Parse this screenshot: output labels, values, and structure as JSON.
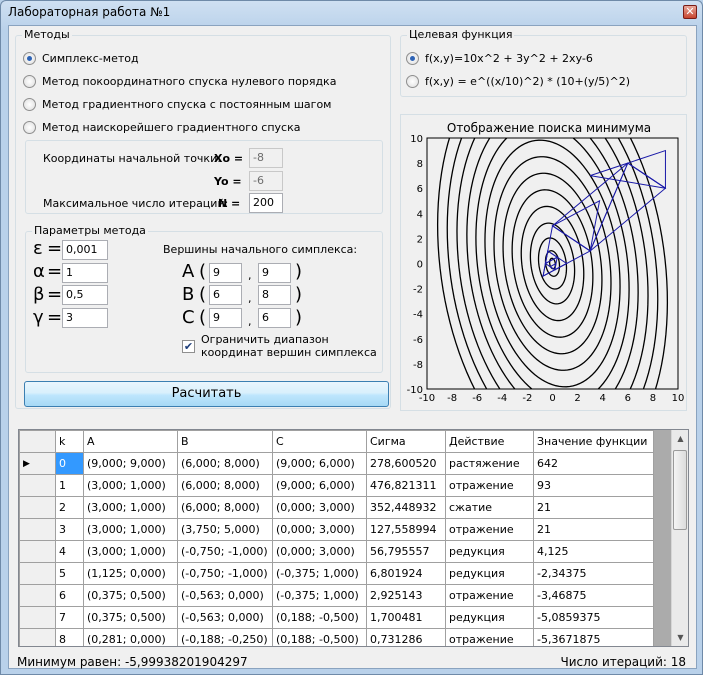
{
  "window": {
    "title": "Лабораторная работа №1",
    "close_glyph": "✕"
  },
  "methods": {
    "title": "Методы",
    "items": [
      {
        "label": "Симплекс-метод",
        "checked": true
      },
      {
        "label": "Метод покоординатного спуска нулевого порядка",
        "checked": false
      },
      {
        "label": "Метод градиентного спуска с постоянным шагом",
        "checked": false
      },
      {
        "label": "Метод наискорейшего градиентного спуска",
        "checked": false
      }
    ]
  },
  "start": {
    "coords_label": "Координаты начальной точки:",
    "x0_label": "Xo =",
    "x0_value": "-8",
    "y0_label": "Yo =",
    "y0_value": "-6",
    "max_iter_label": "Максимальное число итераций:",
    "n_label": "N =",
    "n_value": "200"
  },
  "params": {
    "title": "Параметры метода",
    "eps_sym": "ε",
    "eps_value": "0,001",
    "alpha_sym": "α",
    "alpha_value": "1",
    "beta_sym": "β",
    "beta_value": "0,5",
    "gamma_sym": "γ",
    "gamma_value": "3",
    "eq": "=",
    "vertices_label": "Вершины начального симплекса:",
    "A": {
      "name": "A",
      "x": "9",
      "y": "9"
    },
    "B": {
      "name": "B",
      "x": "6",
      "y": "8"
    },
    "C": {
      "name": "C",
      "x": "9",
      "y": "6"
    },
    "restrict_label_1": "Ограничить диапазон",
    "restrict_label_2": "координат вершин симплекса",
    "restrict_checked": true
  },
  "calc_button": "Расчитать",
  "target": {
    "title": "Целевая функция",
    "f1": "f(x,y)=10x^2 + 3y^2 + 2xy-6",
    "f2": "f(x,y) = e^((x/10)^2) * (10+(y/5)^2)",
    "selected": 0
  },
  "plot": {
    "title": "Отображение поиска минимума",
    "x_ticks": [
      "-10",
      "-8",
      "-6",
      "-4",
      "-2",
      "0",
      "2",
      "4",
      "6",
      "8",
      "10"
    ],
    "y_ticks": [
      "10",
      "8",
      "6",
      "4",
      "2",
      "0",
      "-2",
      "-4",
      "-6",
      "-8",
      "-10"
    ]
  },
  "chart_data": {
    "type": "line",
    "title": "Отображение поиска минимума",
    "xlim": [
      -10,
      10
    ],
    "ylim": [
      -10,
      10
    ],
    "contours": "ellipses of f(x,y)=10x^2+3y^2+2xy-6 centered near (0,0)",
    "simplex_triangles": [
      [
        [
          9,
          9
        ],
        [
          6,
          8
        ],
        [
          9,
          6
        ]
      ],
      [
        [
          3,
          7
        ],
        [
          6,
          8
        ],
        [
          9,
          6
        ]
      ],
      [
        [
          3,
          1
        ],
        [
          6,
          8
        ],
        [
          9,
          6
        ]
      ],
      [
        [
          3,
          1
        ],
        [
          6,
          8
        ],
        [
          0,
          3
        ]
      ],
      [
        [
          3,
          1
        ],
        [
          3.75,
          5
        ],
        [
          0,
          3
        ]
      ],
      [
        [
          3,
          1
        ],
        [
          -0.75,
          -1
        ],
        [
          0,
          3
        ]
      ],
      [
        [
          1.125,
          0
        ],
        [
          -0.75,
          -1
        ],
        [
          -0.375,
          1
        ]
      ],
      [
        [
          0.375,
          0.5
        ],
        [
          -0.563,
          0
        ],
        [
          -0.375,
          1
        ]
      ],
      [
        [
          0.375,
          0.5
        ],
        [
          -0.563,
          0
        ],
        [
          0.188,
          -0.5
        ]
      ],
      [
        [
          0.281,
          0
        ],
        [
          -0.188,
          -0.25
        ],
        [
          0.188,
          -0.5
        ]
      ]
    ]
  },
  "grid": {
    "columns": [
      "k",
      "A",
      "B",
      "C",
      "Сигма",
      "Действие",
      "Значение функции"
    ],
    "rows": [
      [
        "0",
        "(9,000; 9,000)",
        "(6,000; 8,000)",
        "(9,000; 6,000)",
        "278,600520",
        "растяжение",
        "642"
      ],
      [
        "1",
        "(3,000; 1,000)",
        "(6,000; 8,000)",
        "(9,000; 6,000)",
        "476,821311",
        "отражение",
        "93"
      ],
      [
        "2",
        "(3,000; 1,000)",
        "(6,000; 8,000)",
        "(0,000; 3,000)",
        "352,448932",
        "сжатие",
        "21"
      ],
      [
        "3",
        "(3,000; 1,000)",
        "(3,750; 5,000)",
        "(0,000; 3,000)",
        "127,558994",
        "отражение",
        "21"
      ],
      [
        "4",
        "(3,000; 1,000)",
        "(-0,750; -1,000)",
        "(0,000; 3,000)",
        "56,795557",
        "редукция",
        "4,125"
      ],
      [
        "5",
        "(1,125; 0,000)",
        "(-0,750; -1,000)",
        "(-0,375; 1,000)",
        "6,801924",
        "редукция",
        "-2,34375"
      ],
      [
        "6",
        "(0,375; 0,500)",
        "(-0,563; 0,000)",
        "(-0,375; 1,000)",
        "2,925143",
        "отражение",
        "-3,46875"
      ],
      [
        "7",
        "(0,375; 0,500)",
        "(-0,563; 0,000)",
        "(0,188; -0,500)",
        "1,700481",
        "редукция",
        "-5,0859375"
      ],
      [
        "8",
        "(0,281; 0,000)",
        "(-0,188; -0,250)",
        "(0,188; -0,500)",
        "0,731286",
        "отражение",
        "-5,3671875"
      ]
    ],
    "current_row_glyph": "▶"
  },
  "status": {
    "min_label": "Минимум равен: -5,99938201904297",
    "iter_label": "Число итераций: 18"
  },
  "colors": {
    "path": "#1a1aa8",
    "selection": "#3399ff"
  }
}
